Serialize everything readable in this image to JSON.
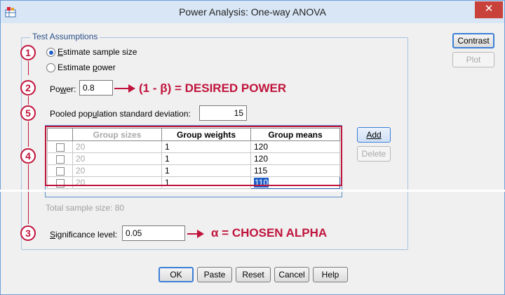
{
  "window": {
    "title": "Power Analysis: One-way ANOVA",
    "close_glyph": "✕"
  },
  "group": {
    "legend": "Test Assumptions"
  },
  "radios": [
    {
      "label": "Estimate sample size",
      "mnemonic": "E",
      "rest": "stimate sample size",
      "checked": true
    },
    {
      "label": "Estimate power",
      "prefix": "Estimate ",
      "mnemonic": "p",
      "rest": "ower",
      "checked": false
    }
  ],
  "power": {
    "label_prefix": "Po",
    "label_mnemonic": "w",
    "label_rest": "er:",
    "value": "0.8"
  },
  "pooled_sd": {
    "label_prefix": "Pooled pop",
    "label_mnemonic": "u",
    "label_rest": "lation standard deviation:",
    "value": "15"
  },
  "table": {
    "headers": [
      "",
      "Group sizes",
      "Group weights",
      "Group means"
    ],
    "rows": [
      {
        "size": "20",
        "weight": "1",
        "mean": "120"
      },
      {
        "size": "20",
        "weight": "1",
        "mean": "120"
      },
      {
        "size": "20",
        "weight": "1",
        "mean": "115"
      },
      {
        "size": "20",
        "weight": "1",
        "mean": "110"
      }
    ]
  },
  "total_sample_size": "Total sample size: 80",
  "significance": {
    "label_mnemonic": "S",
    "label_rest": "ignificance level:",
    "value": "0.05"
  },
  "side_buttons": {
    "contrast": "Contrast",
    "plot": "Plot",
    "add": "Add",
    "delete": "Delete"
  },
  "bottom_buttons": {
    "ok": "OK",
    "paste": "Paste",
    "reset": "Reset",
    "cancel": "Cancel",
    "help": "Help"
  },
  "annotations": {
    "markers": [
      "1",
      "2",
      "5",
      "4",
      "3"
    ],
    "power_note": "(1 - β) = DESIRED POWER",
    "alpha_note": "α = CHOSEN ALPHA"
  },
  "colors": {
    "annotation": "#c0143c",
    "accent": "#3c7fd6",
    "selection": "#1f5ec7"
  }
}
